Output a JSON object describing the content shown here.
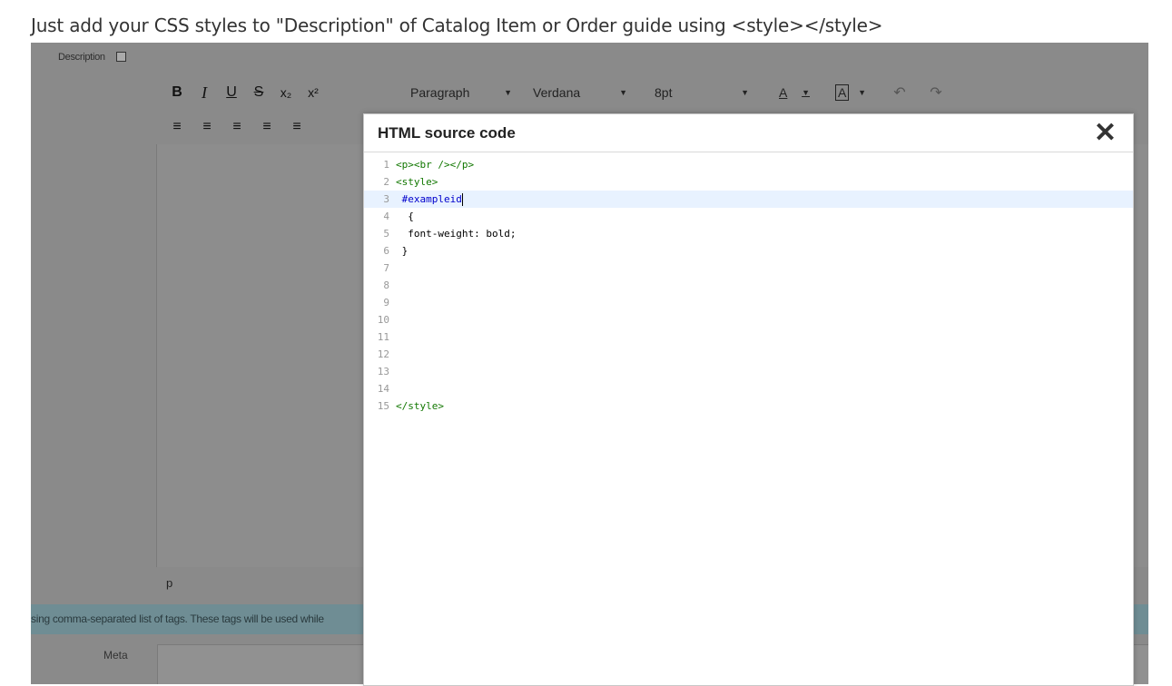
{
  "caption": "Just add your CSS styles to \"Description\" of Catalog Item or Order guide using <style></style>",
  "form": {
    "description_label": "Description",
    "status_path": "p",
    "tags_hint": "sing comma-separated list of tags. These tags will be used while",
    "meta_label": "Meta"
  },
  "toolbar": {
    "bold": "B",
    "italic": "I",
    "underline": "U",
    "strike": "S",
    "subscript": "x₂",
    "superscript": "x²",
    "format": "Paragraph",
    "font": "Verdana",
    "size": "8pt",
    "text_color": "A",
    "bg_color": "A",
    "undo": "↶",
    "redo": "↷",
    "align_left": "≡",
    "align_center": "≡",
    "align_right": "≡",
    "justify": "≡",
    "indent": "≡"
  },
  "modal": {
    "title": "HTML source code",
    "close": "✕",
    "lines": [
      {
        "n": "1",
        "code": "<p><br /></p>"
      },
      {
        "n": "2",
        "code": "<style>"
      },
      {
        "n": "3",
        "code": " #exampleid"
      },
      {
        "n": "4",
        "code": "  {"
      },
      {
        "n": "5",
        "code": "  font-weight: bold;"
      },
      {
        "n": "6",
        "code": " }"
      },
      {
        "n": "7",
        "code": ""
      },
      {
        "n": "8",
        "code": ""
      },
      {
        "n": "9",
        "code": ""
      },
      {
        "n": "10",
        "code": ""
      },
      {
        "n": "11",
        "code": ""
      },
      {
        "n": "12",
        "code": ""
      },
      {
        "n": "13",
        "code": ""
      },
      {
        "n": "14",
        "code": ""
      },
      {
        "n": "15",
        "code": "</style>"
      }
    ]
  }
}
